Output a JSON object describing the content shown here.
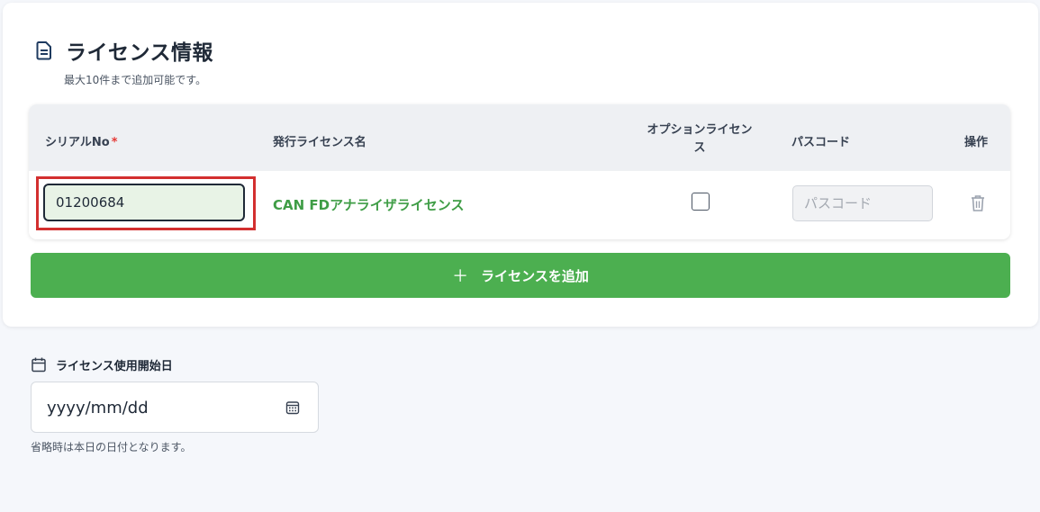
{
  "section": {
    "title": "ライセンス情報",
    "subtitle": "最大10件まで追加可能です。",
    "icon": "document-icon"
  },
  "table": {
    "headers": {
      "serial": "シリアルNo",
      "serial_required": "*",
      "license_name": "発行ライセンス名",
      "option_line1": "オプションライセン",
      "option_line2": "ス",
      "passcode": "パスコード",
      "actions": "操作"
    },
    "rows": [
      {
        "serial": "01200684",
        "license_name": "CAN FDアナライザライセンス",
        "option_checked": false,
        "passcode_placeholder": "パスコード",
        "delete_icon": "trash-icon"
      }
    ]
  },
  "add_button": {
    "label": "ライセンスを追加",
    "icon": "plus-icon"
  },
  "start_date": {
    "label": "ライセンス使用開始日",
    "placeholder": "yyyy/mm/dd",
    "help": "省略時は本日の日付となります。",
    "icon": "calendar-icon"
  },
  "colors": {
    "accent": "#4caf50",
    "license_name": "#3f9d46",
    "highlight": "#d32f2f",
    "required": "#e53935",
    "serial_bg": "#e8f3e6"
  }
}
